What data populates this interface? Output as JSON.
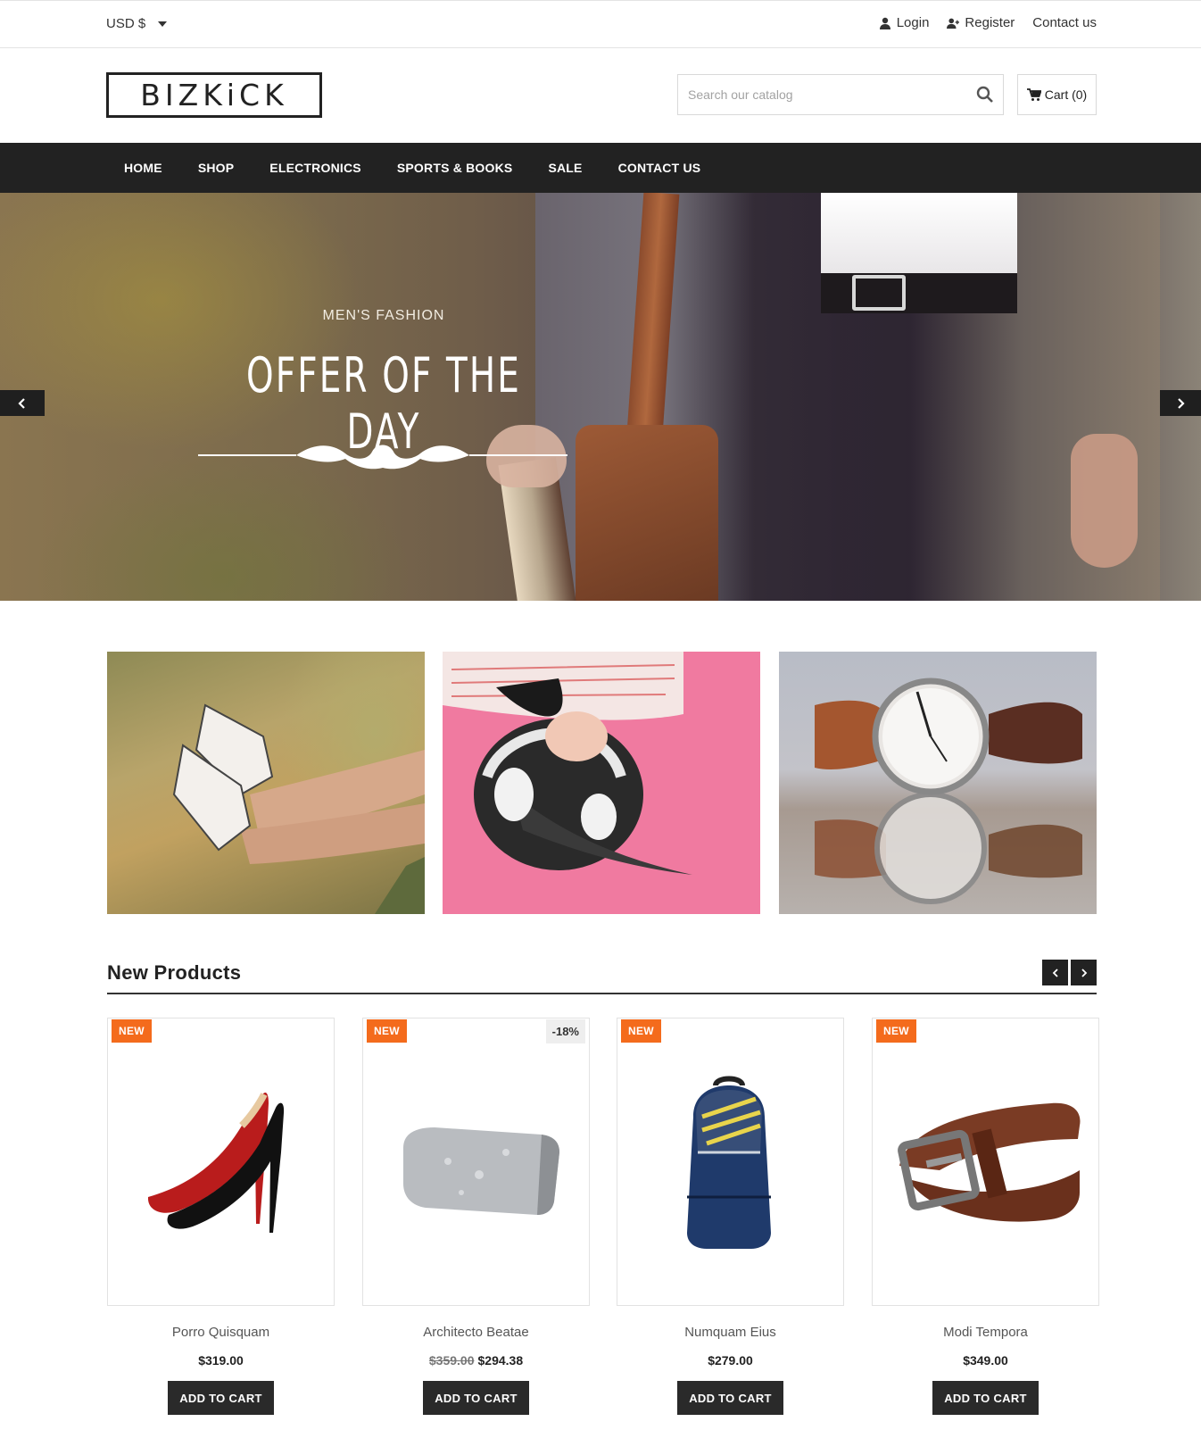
{
  "topbar": {
    "currency": "USD $",
    "links": {
      "login": "Login",
      "register": "Register",
      "contact": "Contact us"
    }
  },
  "header": {
    "logo": "BIZKiCK",
    "search_placeholder": "Search our catalog",
    "cart_label": "Cart (0)"
  },
  "nav": {
    "items": [
      "HOME",
      "SHOP",
      "ELECTRONICS",
      "SPORTS & BOOKS",
      "SALE",
      "CONTACT US"
    ]
  },
  "hero": {
    "subtitle": "MEN'S FASHION",
    "title": "OFFER OF THE DAY"
  },
  "new_products": {
    "title": "New Products",
    "products": [
      {
        "badge": "NEW",
        "name": "Porro Quisquam",
        "price": "$319.00",
        "old_price": "",
        "discount": "",
        "button": "ADD TO CART",
        "icon": "high-heels-image"
      },
      {
        "badge": "NEW",
        "name": "Architecto Beatae",
        "price": "$294.38",
        "old_price": "$359.00",
        "discount": "-18%",
        "button": "ADD TO CART",
        "icon": "clutch-bag-image"
      },
      {
        "badge": "NEW",
        "name": "Numquam Eius",
        "price": "$279.00",
        "old_price": "",
        "discount": "",
        "button": "ADD TO CART",
        "icon": "backpack-image"
      },
      {
        "badge": "NEW",
        "name": "Modi Tempora",
        "price": "$349.00",
        "old_price": "",
        "discount": "",
        "button": "ADD TO CART",
        "icon": "leather-belt-image"
      }
    ]
  },
  "colors": {
    "nav_bg": "#222222",
    "badge_new": "#f46b1c",
    "button_bg": "#2a2a2a"
  }
}
